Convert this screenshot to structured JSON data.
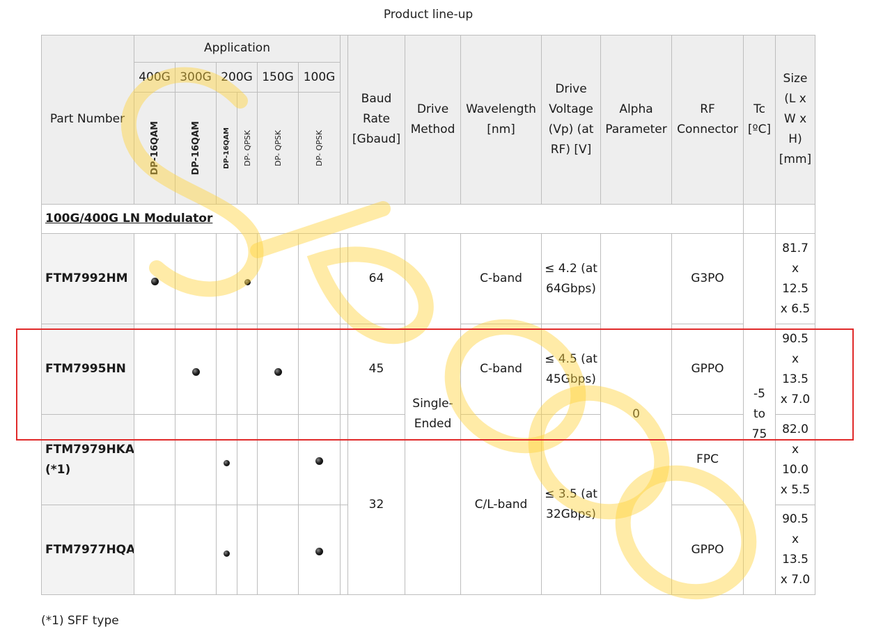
{
  "caption": "Product line-up",
  "headers": {
    "part_number": "Part Number",
    "application": "Application",
    "groups": [
      "400G",
      "300G",
      "200G",
      "150G",
      "100G"
    ],
    "modes": [
      "DP-16QAM",
      "DP-16QAM",
      "DP-16QAM",
      "DP- QPSK",
      "DP- QPSK",
      "DP- QPSK"
    ],
    "baud_rate": "Baud Rate [Gbaud]",
    "drive_method": "Drive Method",
    "wavelength": "Wavelength [nm]",
    "drive_voltage": "Drive Voltage (Vp) (at RF) [V]",
    "alpha": "Alpha Parameter",
    "rf_connector": "RF Connector",
    "tc": "Tc [ºC]",
    "size": "Size (L x W x H) [mm]"
  },
  "section_label": "100G/400G LN Modulator",
  "rows": [
    {
      "part": "FTM7992HM",
      "dots": [
        true,
        false,
        false,
        true,
        false,
        false
      ],
      "baud": "64",
      "wavelength": "C-band",
      "voltage": "≤ 4.2 (at 64Gbps)",
      "rf": "G3PO",
      "size": "81.7 x 12.5 x 6.5"
    },
    {
      "part": "FTM7995HN",
      "dots": [
        false,
        true,
        false,
        false,
        true,
        false
      ],
      "baud": "45",
      "wavelength": "C-band",
      "voltage": "≤ 4.5 (at 45Gbps)",
      "rf": "GPPO",
      "size": "90.5 x 13.5 x 7.0"
    },
    {
      "part": "FTM7979HKA (*1)",
      "dots": [
        false,
        false,
        true,
        false,
        false,
        true
      ],
      "rf": "FPC",
      "size": "82.0 x 10.0 x 5.5"
    },
    {
      "part": "FTM7977HQA",
      "dots": [
        false,
        false,
        true,
        false,
        false,
        true
      ],
      "rf": "GPPO",
      "size": "90.5 x 13.5 x 7.0"
    }
  ],
  "merged": {
    "drive_method": "Single- Ended",
    "alpha": "0",
    "tc": "-5 to 75",
    "baud_32": "32",
    "wavelength_cl": "C/L-band",
    "voltage_32": "≤ 3.5 (at 32Gbps)"
  },
  "footnote": "(*1) SFF type",
  "colors": {
    "header_bg": "#eeeeee",
    "highlight": "#e02a2a",
    "watermark": "#ffd23c"
  }
}
